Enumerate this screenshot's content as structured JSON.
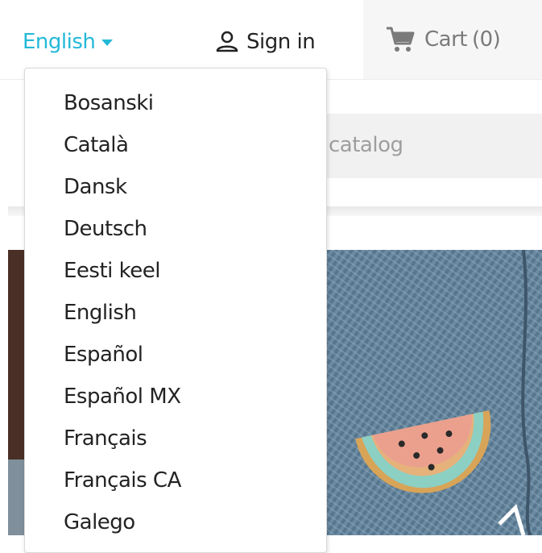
{
  "header": {
    "language_current": "English",
    "signin_label": "Sign in",
    "cart_label": "Cart",
    "cart_count": "(0)"
  },
  "search": {
    "placeholder_visible": "catalog"
  },
  "language_menu": {
    "items": [
      "Bosanski",
      "Català",
      "Dansk",
      "Deutsch",
      "Eesti keel",
      "English",
      "Español",
      "Español MX",
      "Français",
      "Français CA",
      "Galego"
    ]
  },
  "colors": {
    "accent": "#24b9d7",
    "text": "#232323",
    "muted": "#7a7a7a"
  },
  "icons": {
    "language": "caret-down-icon",
    "signin": "user-icon",
    "cart": "cart-icon"
  }
}
